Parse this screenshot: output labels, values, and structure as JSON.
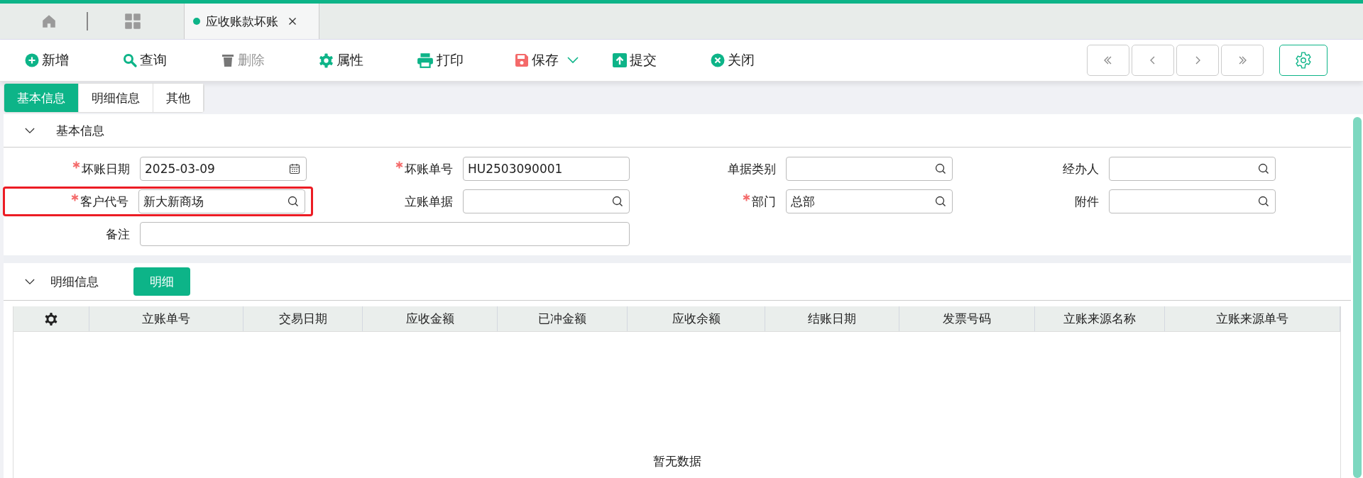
{
  "doc_tabs": [
    {
      "label": "应收账款坏账",
      "selected": true
    }
  ],
  "toolbar": [
    {
      "kind": "add",
      "label": "新增",
      "disabled": false
    },
    {
      "kind": "search",
      "label": "查询",
      "disabled": false
    },
    {
      "kind": "delete",
      "label": "删除",
      "disabled": true
    },
    {
      "kind": "gear",
      "label": "属性",
      "disabled": false
    },
    {
      "kind": "print",
      "label": "打印",
      "disabled": false
    },
    {
      "kind": "save",
      "label": "保存",
      "disabled": false,
      "has_dropdown": true
    },
    {
      "kind": "submit",
      "label": "提交",
      "disabled": false
    },
    {
      "kind": "close",
      "label": "关闭",
      "disabled": false
    }
  ],
  "nav_buttons": [
    {
      "kind": "first"
    },
    {
      "kind": "prev"
    },
    {
      "kind": "next"
    },
    {
      "kind": "last"
    }
  ],
  "sub_tabs": [
    {
      "label": "基本信息",
      "selected": true
    },
    {
      "label": "明细信息",
      "selected": false
    },
    {
      "label": "其他",
      "selected": false
    }
  ],
  "basic_section": {
    "title": "基本信息",
    "expanded": true,
    "fields": [
      {
        "label": "坏账日期",
        "required": true,
        "value": "2025-03-09",
        "kind": "date",
        "highlighted": false
      },
      {
        "label": "坏账单号",
        "required": true,
        "value": "HU2503090001",
        "kind": "text",
        "highlighted": false
      },
      {
        "label": "单据类别",
        "required": false,
        "kind": "lookup",
        "highlighted": false
      },
      {
        "label": "经办人",
        "required": false,
        "kind": "lookup",
        "highlighted": false
      },
      {
        "label": "客户代号",
        "required": true,
        "value": "新大新商场",
        "kind": "lookup",
        "highlighted": true
      },
      {
        "label": "立账单据",
        "required": false,
        "kind": "lookup",
        "highlighted": false
      },
      {
        "label": "部门",
        "required": true,
        "value": "总部",
        "kind": "lookup",
        "highlighted": false
      },
      {
        "label": "附件",
        "required": false,
        "kind": "lookup",
        "highlighted": false
      },
      {
        "label": "备注",
        "required": false,
        "kind": "wide",
        "highlighted": false
      }
    ]
  },
  "detail_section": {
    "title": "明细信息",
    "expanded": true,
    "button": "明细",
    "table": {
      "columns": [
        "立账单号",
        "交易日期",
        "应收金额",
        "已冲金额",
        "应收余额",
        "结账日期",
        "发票号码",
        "立账来源名称",
        "立账来源单号"
      ],
      "empty_text": "暂无数据"
    }
  }
}
